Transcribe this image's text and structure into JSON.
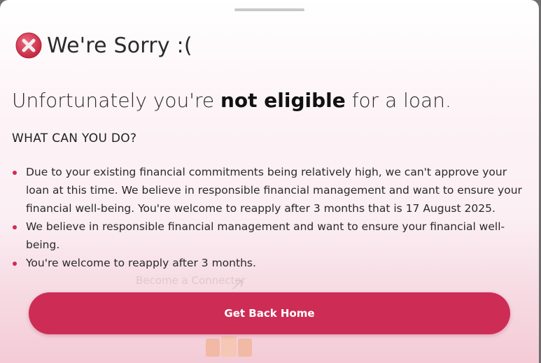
{
  "modal": {
    "title": "We're Sorry :(",
    "title_icon": "error-x-icon",
    "headline": {
      "prefix": "Unfortunately you're ",
      "emphasis": "not eligible",
      "suffix": " for a loan."
    },
    "section_heading": "WHAT CAN YOU DO?",
    "reasons": [
      "Due to your existing financial commitments being relatively high, we can't approve your loan at this time. We believe in responsible financial management and want to ensure your financial well-being. You're welcome to reapply after 3 months that is 17 August 2025.",
      "We believe in responsible financial management and want to ensure your financial well-being.",
      "You're welcome to reapply after 3 months."
    ],
    "primary_button_label": "Get Back Home"
  },
  "background_page": {
    "faded_link_text": "Become a Connector",
    "faded_link_icon": "arrow-up-right-icon"
  },
  "colors": {
    "accent": "#cd2d55",
    "bullet": "#d12b56",
    "error_icon": "#d6334f"
  }
}
